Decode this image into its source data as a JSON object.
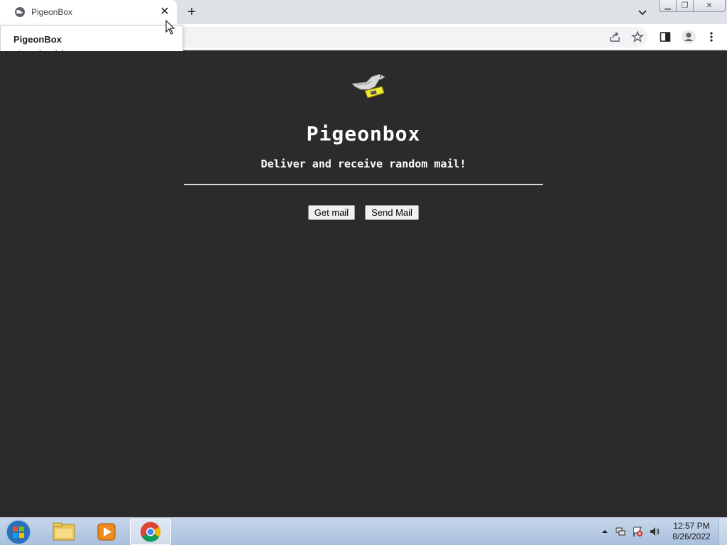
{
  "browser": {
    "tab": {
      "title": "PigeonBox",
      "favicon": "globe-icon",
      "close_glyph": "✕"
    },
    "new_tab_glyph": "+",
    "hover_card": {
      "title": "PigeonBox",
      "url": "pigeonbox.lol"
    },
    "toolbar_icons": [
      "share-icon",
      "star-icon",
      "side-panel-icon",
      "profile-icon",
      "menu-icon"
    ]
  },
  "page": {
    "title": "Pigeonbox",
    "subtitle": "Deliver and receive random mail!",
    "buttons": {
      "get_mail": "Get mail",
      "send_mail": "Send Mail"
    }
  },
  "taskbar": {
    "apps": [
      "windows-explorer",
      "media-player",
      "chrome"
    ],
    "clock": {
      "time": "12:57 PM",
      "date": "8/26/2022"
    }
  },
  "colors": {
    "page_background": "#2b2b2b",
    "text": "#ffffff",
    "taskbar": "#b7cbe3"
  }
}
